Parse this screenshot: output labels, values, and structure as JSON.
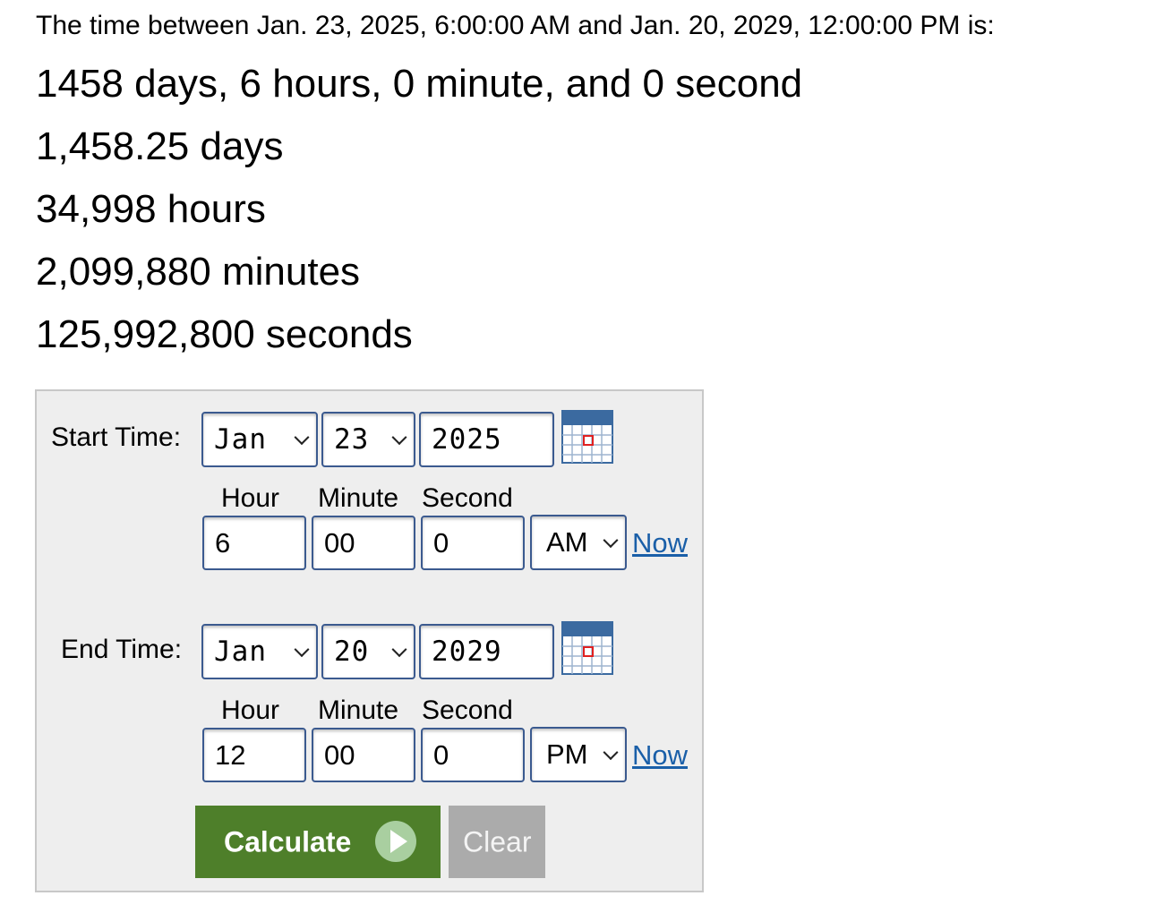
{
  "results": {
    "intro": "The time between Jan. 23, 2025, 6:00:00 AM and Jan. 20, 2029, 12:00:00 PM is:",
    "lines": [
      "1458 days, 6 hours, 0 minute, and 0 second",
      "1,458.25 days",
      "34,998 hours",
      "2,099,880 minutes",
      "125,992,800 seconds"
    ]
  },
  "form": {
    "start": {
      "label": "Start Time:",
      "month": "Jan",
      "day": "23",
      "year": "2025",
      "hour_label": "Hour",
      "minute_label": "Minute",
      "second_label": "Second",
      "hour": "6",
      "minute": "00",
      "second": "0",
      "ampm": "AM",
      "now_label": "Now"
    },
    "end": {
      "label": "End Time:",
      "month": "Jan",
      "day": "20",
      "year": "2029",
      "hour_label": "Hour",
      "minute_label": "Minute",
      "second_label": "Second",
      "hour": "12",
      "minute": "00",
      "second": "0",
      "ampm": "PM",
      "now_label": "Now"
    },
    "buttons": {
      "calculate": "Calculate",
      "clear": "Clear"
    },
    "icons": {
      "calendar": "calendar-icon",
      "play": "play-icon",
      "dropdown": "chevron-down-icon"
    },
    "colors": {
      "calculate_bg": "#4e7f2a",
      "clear_bg": "#ababab",
      "link": "#1a5fa8",
      "field_border": "#3b5a8f",
      "panel_bg": "#eeeeee"
    }
  }
}
